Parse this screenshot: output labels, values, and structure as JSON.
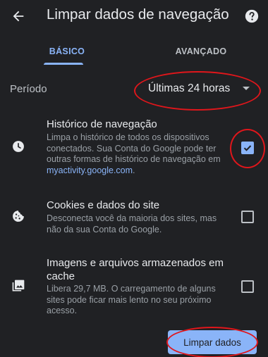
{
  "header": {
    "title": "Limpar dados de navegação",
    "back_icon": "arrow-back-icon",
    "help_icon": "help-icon"
  },
  "tabs": [
    {
      "label": "BÁSICO",
      "selected": true
    },
    {
      "label": "AVANÇADO",
      "selected": false
    }
  ],
  "period": {
    "label": "Período",
    "value": "Últimas 24 horas"
  },
  "items": [
    {
      "icon": "clock-icon",
      "title": "Histórico de navegação",
      "desc": "Limpa o histórico de todos os dispositivos conectados. Sua Conta do Google pode ter outras formas de histórico de navegação em",
      "link": "myactivity.google.com",
      "desc_end": ".",
      "checked": true
    },
    {
      "icon": "cookie-icon",
      "title": "Cookies e dados do site",
      "desc": "Desconecta você da maioria dos sites, mas não da sua Conta do Google.",
      "checked": false
    },
    {
      "icon": "image-icon",
      "title": "Imagens e arquivos armazenados em cache",
      "desc": "Libera 29,7 MB. O carregamento de alguns sites pode ficar mais lento no seu próximo acesso.",
      "checked": false
    }
  ],
  "clear_button": {
    "label": "Limpar dados"
  },
  "colors": {
    "background": "#202124",
    "accent": "#8ab4f8",
    "annotation": "#e0161b"
  }
}
